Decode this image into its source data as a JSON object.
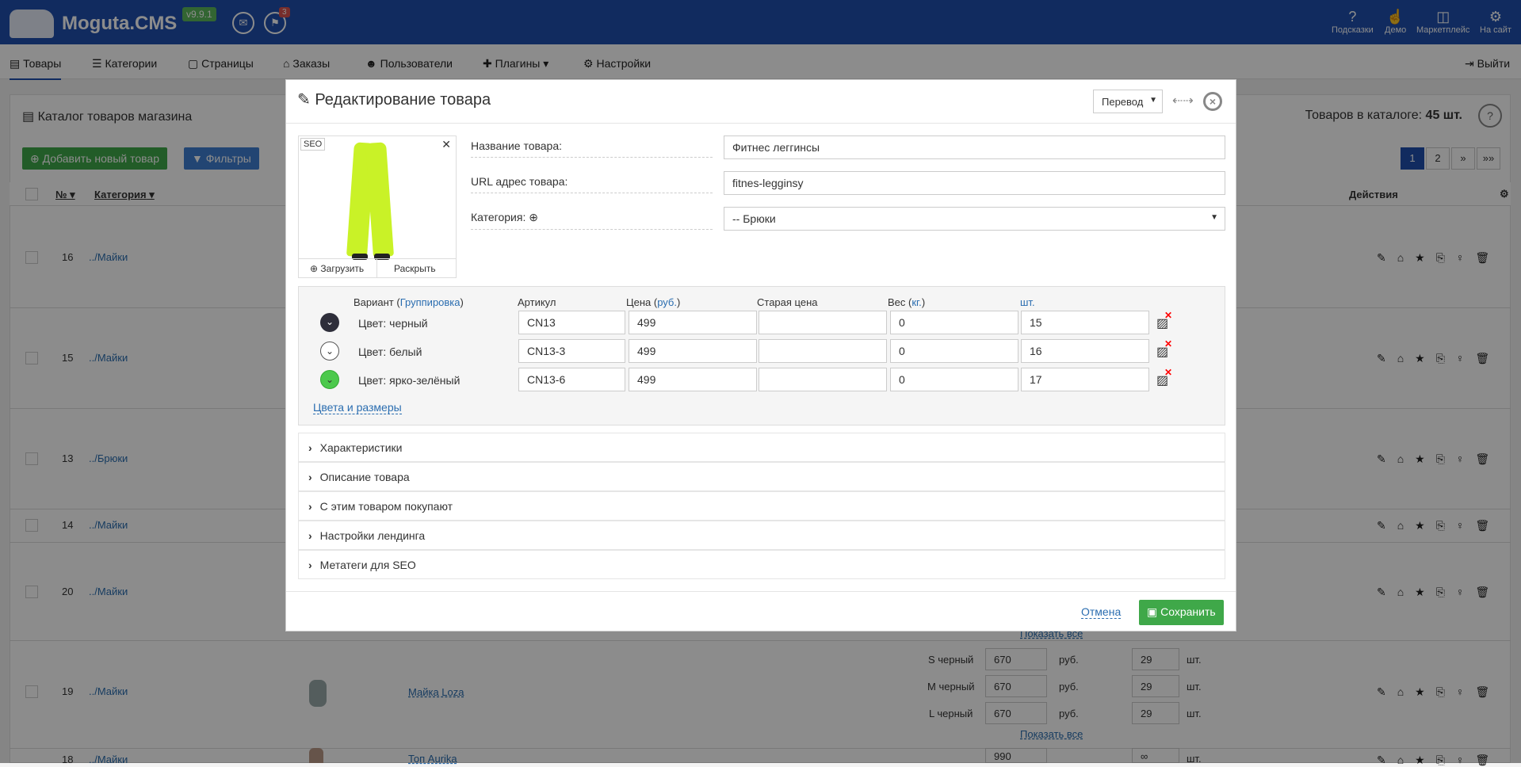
{
  "header": {
    "logo": "Moguta.CMS",
    "version": "v9.9.1",
    "cart_badge": "3",
    "right": [
      {
        "label": "Подсказки",
        "icon": "question-icon"
      },
      {
        "label": "Демо",
        "icon": "demo-icon"
      },
      {
        "label": "Маркетплейс",
        "icon": "marketplace-icon"
      },
      {
        "label": "На сайт",
        "icon": "site-icon"
      }
    ]
  },
  "nav": {
    "items": [
      "Товары",
      "Категории",
      "Страницы",
      "Заказы",
      "Пользователи",
      "Плагины",
      "Настройки"
    ],
    "logout": "Выйти"
  },
  "catalog": {
    "title": "Каталог товаров магазина",
    "count_label": "Товаров в каталоге:",
    "count_value": "45 шт.",
    "add_button": "Добавить новый товар",
    "filters_button": "Фильтры",
    "pages": [
      "1",
      "2",
      "»",
      "»»"
    ],
    "columns": {
      "num": "№",
      "category": "Категория",
      "actions": "Действия"
    },
    "rows": [
      {
        "num": "16",
        "cat": "../Майки"
      },
      {
        "num": "15",
        "cat": "../Майки"
      },
      {
        "num": "13",
        "cat": "../Брюки"
      },
      {
        "num": "14",
        "cat": "../Майки"
      },
      {
        "num": "20",
        "cat": "../Майки"
      },
      {
        "num": "19",
        "cat": "../Майки"
      },
      {
        "num": "18",
        "cat": "../Майки"
      }
    ],
    "row19": {
      "name": "Майка Loza",
      "variants": [
        {
          "name": "S черный",
          "price": "670",
          "qty": "29"
        },
        {
          "name": "M черный",
          "price": "670",
          "qty": "29"
        },
        {
          "name": "L черный",
          "price": "670",
          "qty": "29"
        }
      ],
      "currency": "руб.",
      "unit": "шт.",
      "show_all": "Показать все"
    },
    "row18": {
      "name": "Топ Aurika",
      "price": "990",
      "qty": "∞"
    }
  },
  "modal": {
    "title": "Редактирование товара",
    "translate": "Перевод",
    "image": {
      "seo": "SEO",
      "upload": "Загрузить",
      "expand": "Раскрыть"
    },
    "fields": {
      "name_label": "Название товара:",
      "name_value": "Фитнес леггинсы",
      "url_label": "URL адрес товара:",
      "url_value": "fitnes-legginsy",
      "category_label": "Категория:",
      "category_value": "-- Брюки"
    },
    "variants": {
      "h_variant": "Вариант (",
      "h_group": "Группировка",
      "h_close": ")",
      "h_sku": "Артикул",
      "h_price": "Цена (",
      "h_rub": "руб.",
      "h_old": "Старая цена",
      "h_weight": "Вес (",
      "h_kg": "кг.",
      "h_qty": "шт.",
      "rows": [
        {
          "name": "Цвет: черный",
          "sku": "CN13",
          "price": "499",
          "old": "",
          "weight": "0",
          "qty": "15",
          "color": "#2e2e3a"
        },
        {
          "name": "Цвет: белый",
          "sku": "CN13-3",
          "price": "499",
          "old": "",
          "weight": "0",
          "qty": "16",
          "color": "#ffffff"
        },
        {
          "name": "Цвет: ярко-зелёный",
          "sku": "CN13-6",
          "price": "499",
          "old": "",
          "weight": "0",
          "qty": "17",
          "color": "#4cc94c"
        }
      ],
      "link": "Цвета и размеры"
    },
    "sections": [
      "Характеристики",
      "Описание товара",
      "С этим товаром покупают",
      "Настройки лендинга",
      "Метатеги для SEO"
    ],
    "cancel": "Отмена",
    "save": "Сохранить"
  }
}
